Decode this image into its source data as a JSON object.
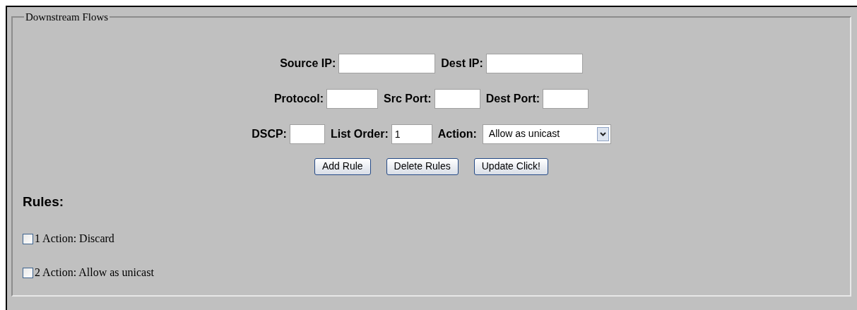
{
  "fieldset": {
    "legend": "Downstream Flows"
  },
  "form_rows": [
    [
      {
        "kind": "text",
        "label": "Source IP:"
      },
      {
        "kind": "text",
        "label": "Dest IP:"
      }
    ],
    [
      {
        "kind": "text",
        "label": "Protocol:"
      },
      {
        "kind": "text",
        "label": "Src Port:"
      },
      {
        "kind": "text",
        "label": "Dest Port:"
      }
    ],
    [
      {
        "kind": "text",
        "label": "DSCP:"
      },
      {
        "kind": "text",
        "label": "List Order:",
        "value": "1"
      },
      {
        "kind": "select",
        "label": "Action:",
        "value": "Allow as unicast"
      }
    ]
  ],
  "buttons": [
    "Add Rule",
    "Delete Rules",
    "Update Click!"
  ],
  "rules_heading": "Rules:",
  "rules": [
    {
      "label": "1 Action: Discard",
      "checked": false
    },
    {
      "label": "2 Action: Allow as unicast",
      "checked": false
    }
  ]
}
